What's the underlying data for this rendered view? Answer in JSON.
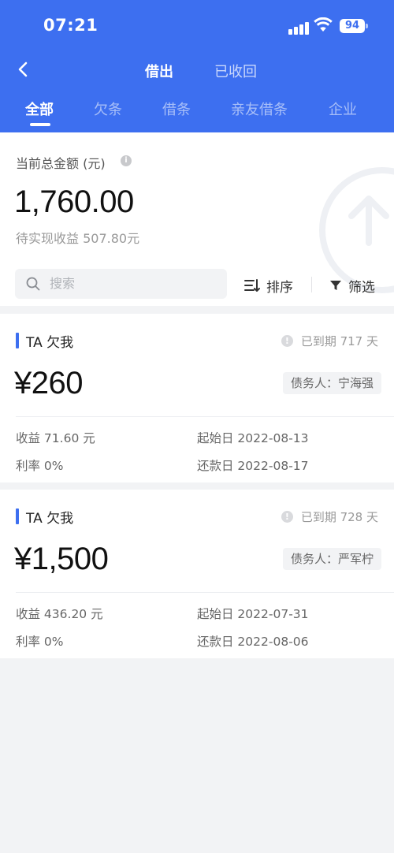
{
  "status_bar": {
    "time": "07:21",
    "battery": "94"
  },
  "header": {
    "top_tabs": [
      {
        "label": "借出"
      },
      {
        "label": "已收回"
      }
    ],
    "category_tabs": [
      {
        "label": "全部"
      },
      {
        "label": "欠条"
      },
      {
        "label": "借条"
      },
      {
        "label": "亲友借条"
      },
      {
        "label": "企业"
      }
    ],
    "accent_color": "#3d6ff0"
  },
  "summary": {
    "label": "当前总金额 (元)",
    "total": "1,760.00",
    "pending_income": "待实现收益 507.80元"
  },
  "toolbar": {
    "search_placeholder": "搜索",
    "sort_label": "排序",
    "filter_label": "筛选"
  },
  "records": [
    {
      "title": "TA 欠我",
      "overdue": "已到期 717 天",
      "amount": "¥260",
      "debtor": "债务人：宁海强",
      "income": "收益 71.60 元",
      "rate": "利率 0%",
      "start_date": "起始日 2022-08-13",
      "due_date": "还款日 2022-08-17"
    },
    {
      "title": "TA 欠我",
      "overdue": "已到期 728 天",
      "amount": "¥1,500",
      "debtor": "债务人：严军柠",
      "income": "收益 436.20 元",
      "rate": "利率 0%",
      "start_date": "起始日 2022-07-31",
      "due_date": "还款日 2022-08-06"
    }
  ]
}
